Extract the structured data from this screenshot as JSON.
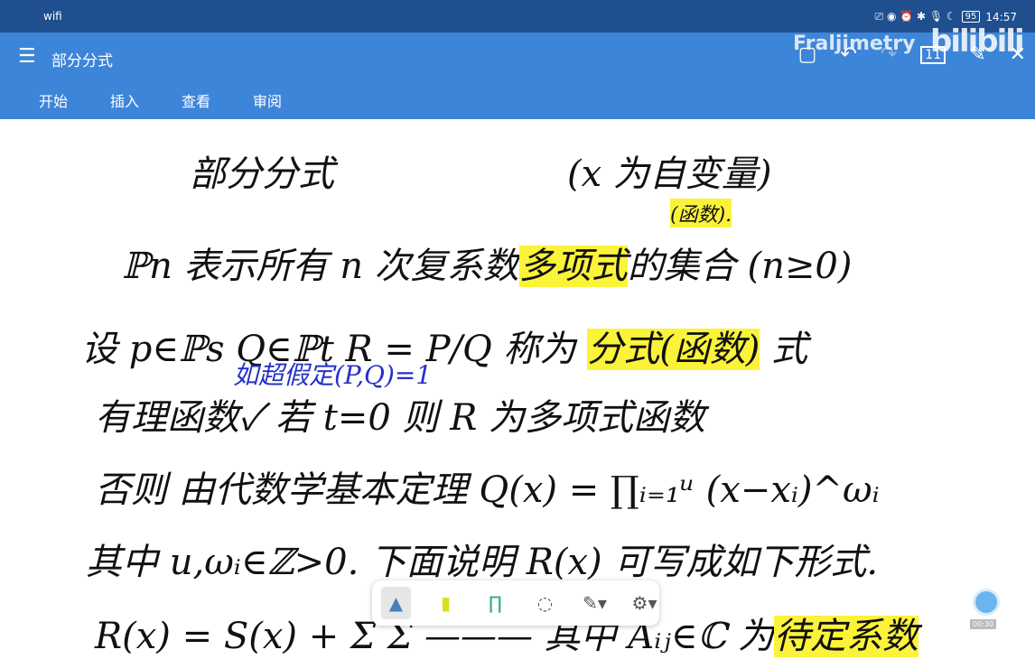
{
  "status": {
    "left_icons": "wifi",
    "battery": "95",
    "time": "14:57"
  },
  "appbar": {
    "title": "部分分式",
    "tabs": [
      "开始",
      "插入",
      "查看",
      "审阅"
    ],
    "watermark": "Fraljimetry",
    "logo": "bilibili",
    "page_count": "11"
  },
  "note": {
    "heading": "部分分式",
    "heading_note": "(x 为自变量)",
    "func_note": "(函数).",
    "l1a": "ℙn 表示所有 n 次复系数",
    "l1b": "多项式",
    "l1c": "的集合 (n≥0)",
    "l2a": "设 p∈ℙs   Q∈ℙt    R = P/Q 称为",
    "l2b": "分式(函数)",
    "l2c": "式",
    "l2blue": "如超假定(P,Q)=1",
    "l3": "有理函数✓ 若 t=0 则 R 为多项式函数",
    "l4": "否则 由代数学基本定理   Q(x) = ∏ᵢ₌₁ᵘ (x−xᵢ)^ωᵢ",
    "l5": "其中 u,ωᵢ∈ℤ>0.   下面说明 R(x) 可写成如下形式.",
    "l6a": "R(x) = S(x) + Σ Σ ———   其中 Aᵢⱼ∈ℂ 为",
    "l6b": "待定系数"
  },
  "toolbar": {
    "rec_time": "00:30"
  }
}
